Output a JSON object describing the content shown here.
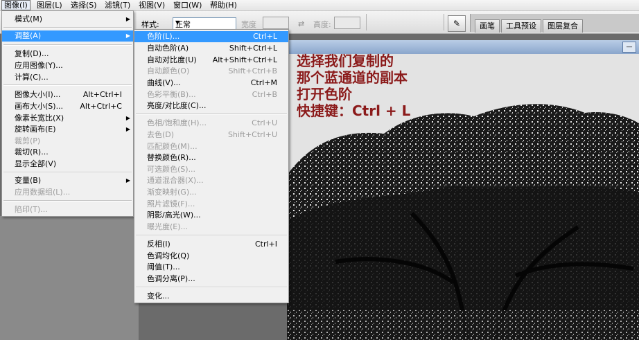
{
  "menubar": [
    "图像(I)",
    "图层(L)",
    "选择(S)",
    "滤镜(T)",
    "视图(V)",
    "窗口(W)",
    "帮助(H)"
  ],
  "options": {
    "style_label": "样式:",
    "style_value": "正常",
    "width_label": "宽度",
    "height_label": "高度:"
  },
  "well_tabs": [
    "画笔",
    "工具预设",
    "图层复合"
  ],
  "image_menu": [
    {
      "label": "模式(M)",
      "sub": true
    },
    {
      "label": "调整(A)",
      "sub": true,
      "highlight": true
    },
    {
      "label": "复制(D)..."
    },
    {
      "label": "应用图像(Y)..."
    },
    {
      "label": "计算(C)..."
    },
    {
      "label": "图像大小(I)...",
      "key": "Alt+Ctrl+I"
    },
    {
      "label": "画布大小(S)...",
      "key": "Alt+Ctrl+C"
    },
    {
      "label": "像素长宽比(X)",
      "sub": true
    },
    {
      "label": "旋转画布(E)",
      "sub": true
    },
    {
      "label": "裁剪(P)",
      "disabled": true
    },
    {
      "label": "裁切(R)..."
    },
    {
      "label": "显示全部(V)"
    },
    {
      "label": "变量(B)",
      "sub": true
    },
    {
      "label": "应用数据组(L)...",
      "disabled": true
    },
    {
      "label": "陷印(T)...",
      "disabled": true
    }
  ],
  "adjust_menu": [
    {
      "label": "色阶(L)...",
      "key": "Ctrl+L",
      "highlight": true
    },
    {
      "label": "自动色阶(A)",
      "key": "Shift+Ctrl+L"
    },
    {
      "label": "自动对比度(U)",
      "key": "Alt+Shift+Ctrl+L"
    },
    {
      "label": "自动颜色(O)",
      "key": "Shift+Ctrl+B",
      "disabled": true
    },
    {
      "label": "曲线(V)...",
      "key": "Ctrl+M"
    },
    {
      "label": "色彩平衡(B)...",
      "key": "Ctrl+B",
      "disabled": true
    },
    {
      "label": "亮度/对比度(C)..."
    },
    {
      "label": "色相/饱和度(H)...",
      "key": "Ctrl+U",
      "disabled": true
    },
    {
      "label": "去色(D)",
      "key": "Shift+Ctrl+U",
      "disabled": true
    },
    {
      "label": "匹配颜色(M)...",
      "disabled": true
    },
    {
      "label": "替换颜色(R)..."
    },
    {
      "label": "可选颜色(S)...",
      "disabled": true
    },
    {
      "label": "通道混合器(X)...",
      "disabled": true
    },
    {
      "label": "渐变映射(G)...",
      "disabled": true
    },
    {
      "label": "照片滤镜(F)...",
      "disabled": true
    },
    {
      "label": "阴影/高光(W)..."
    },
    {
      "label": "曝光度(E)...",
      "disabled": true
    },
    {
      "label": "反相(I)",
      "key": "Ctrl+I"
    },
    {
      "label": "色调均化(Q)"
    },
    {
      "label": "阈值(T)..."
    },
    {
      "label": "色调分离(P)..."
    },
    {
      "label": "变化..."
    }
  ],
  "annotation": [
    "选择我们复制的",
    "那个蓝通道的副本",
    "打开色阶",
    "快捷键：Ctrl + L"
  ],
  "colors": {
    "highlight": "#3399ff",
    "annotation": "#8b1a1a"
  }
}
